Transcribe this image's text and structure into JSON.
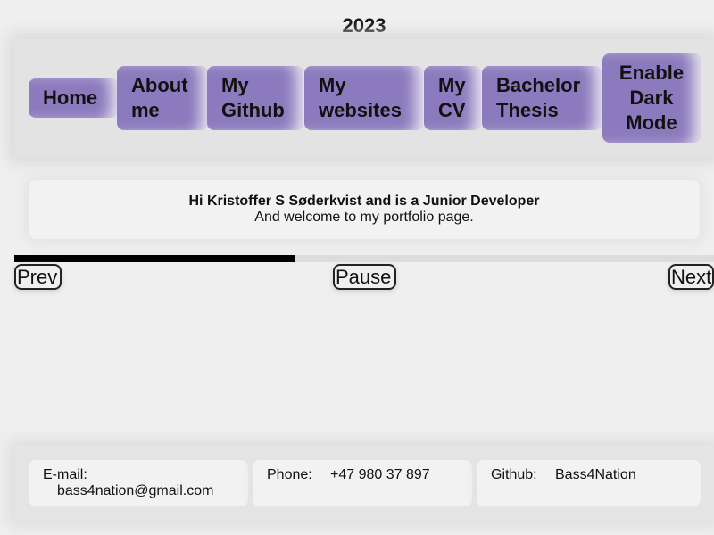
{
  "header": {
    "year": "2023"
  },
  "nav": {
    "items": [
      {
        "lines": [
          "Home"
        ]
      },
      {
        "lines": [
          "About",
          "me"
        ]
      },
      {
        "lines": [
          "My",
          "Github"
        ]
      },
      {
        "lines": [
          "My",
          "websites"
        ]
      },
      {
        "lines": [
          "My",
          "CV"
        ]
      },
      {
        "lines": [
          "Bachelor",
          "Thesis"
        ]
      },
      {
        "lines": [
          "Enable",
          "Dark",
          "Mode"
        ]
      }
    ]
  },
  "intro": {
    "title": "Hi Kristoffer S Søderkvist and is a Junior Developer",
    "subtitle": "And welcome to my portfolio page."
  },
  "slideshow": {
    "progress_fraction": 0.4,
    "prev_label": "Prev",
    "pause_label": "Pause",
    "next_label": "Next"
  },
  "footer": {
    "email_label": "E-mail:",
    "email_value": "bass4nation@gmail.com",
    "phone_label": "Phone:",
    "phone_value": "+47 980 37 897",
    "github_label": "Github:",
    "github_value": "Bass4Nation"
  },
  "colors": {
    "accent": "#8b7abd",
    "progress": "#000000",
    "page_background": "#efefef"
  }
}
